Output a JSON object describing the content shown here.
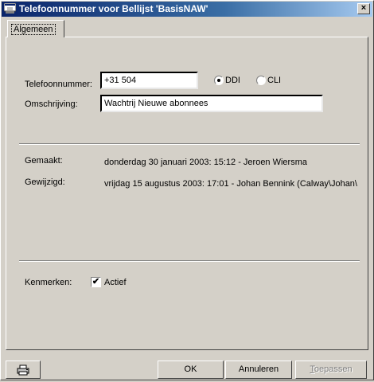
{
  "window": {
    "title": "Telefoonnummer voor Bellijst 'BasisNAW'",
    "close_glyph": "×"
  },
  "tabs": [
    {
      "label": "Algemeen"
    }
  ],
  "form": {
    "phone_label": "Telefoonnummer:",
    "phone_value": "+31 504",
    "radio_ddi": {
      "label": "DDI",
      "checked": true
    },
    "radio_cli": {
      "label": "CLI",
      "checked": false
    },
    "description_label": "Omschrijving:",
    "description_value": "Wachtrij Nieuwe abonnees"
  },
  "info": {
    "created_label": "Gemaakt:",
    "created_value": "donderdag 30 januari 2003: 15:12 - Jeroen Wiersma",
    "modified_label": "Gewijzigd:",
    "modified_value": "vrijdag 15 augustus 2003: 17:01 - Johan Bennink (Calway\\Johan\\"
  },
  "features": {
    "label": "Kenmerken:",
    "active": {
      "label": "Actief",
      "checked": true,
      "mark": "✔"
    }
  },
  "buttons": {
    "ok": "OK",
    "cancel": "Annuleren",
    "apply_first": "T",
    "apply_rest": "oepassen"
  },
  "icons": {
    "print": "printer-icon",
    "app": "phone-window-icon",
    "close": "close-icon"
  }
}
